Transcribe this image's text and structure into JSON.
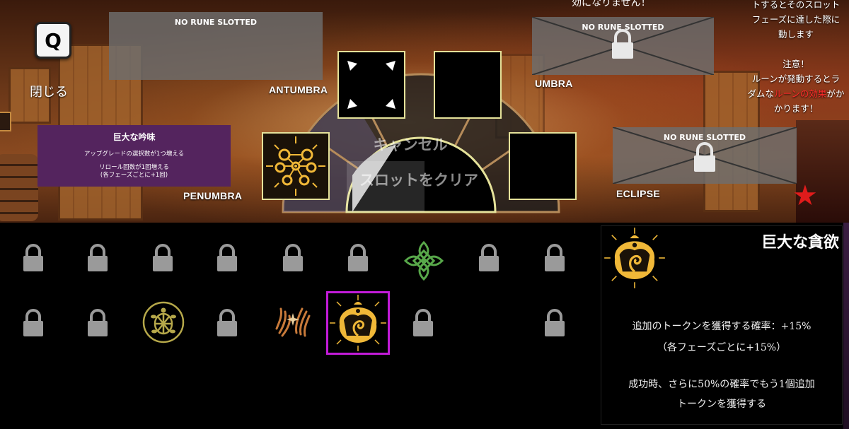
{
  "close": {
    "key": "Q",
    "label": "閉じる"
  },
  "top_cut_text": "効になりません！",
  "slots": {
    "antumbra": {
      "label": "ANTUMBRA",
      "status": "NO RUNE SLOTTED"
    },
    "umbra": {
      "label": "UMBRA",
      "status": "NO RUNE SLOTTED"
    },
    "penumbra": {
      "label": "PENUMBRA",
      "rune_name": "巨大な吟味",
      "line1": "アップグレードの選択数が1つ増える",
      "line2": "リロール回数が1回増える",
      "line3": "(各フェーズごとに+1回)"
    },
    "eclipse": {
      "label": "ECLIPSE",
      "status": "NO RUNE SLOTTED"
    }
  },
  "wheel": {
    "cancel": "キャンセル",
    "clear": "スロットをクリア"
  },
  "notice": {
    "lines": [
      "トするとそのスロット",
      "フェーズに達した際に",
      "動します",
      "",
      "注意！",
      "ルーンが発動するとラ"
    ],
    "line_pre": "ダムな",
    "line_red": "ルーンの効果",
    "line_post": "がか",
    "line_last": "かります！"
  },
  "inventory": {
    "rows": [
      [
        "locked",
        "locked",
        "locked",
        "locked",
        "locked",
        "locked",
        "clover-rune",
        "locked",
        "locked"
      ],
      [
        "locked",
        "locked",
        "turtle-rune",
        "locked",
        "hands-rune",
        "devour-rune",
        "locked",
        "",
        "locked"
      ]
    ]
  },
  "detail": {
    "title": "巨大な貪欲",
    "line1": "追加のトークンを獲得する確率：+15%",
    "line2": "（各フェーズごとに+15%）",
    "line3": "成功時、さらに50%の確率でもう1個追加",
    "line4": "トークンを獲得する"
  },
  "colors": {
    "selection": "#c21bd8",
    "frame": "#e5e29a",
    "rune_gold": "#f0b838",
    "lock": "#9a9a9a"
  }
}
